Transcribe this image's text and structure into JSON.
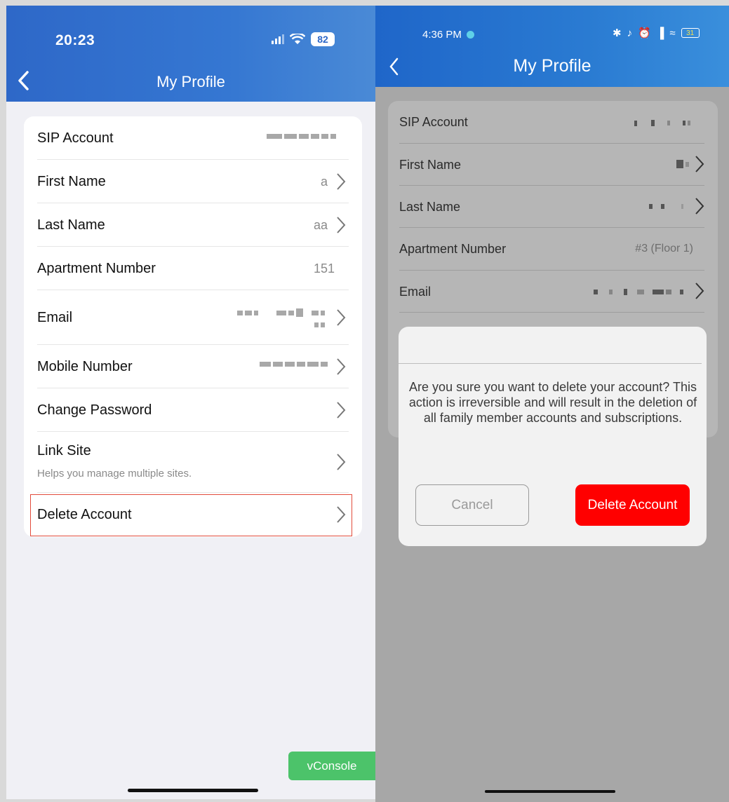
{
  "left": {
    "status": {
      "time": "20:23",
      "battery": "82"
    },
    "header": {
      "title": "My Profile"
    },
    "rows": [
      {
        "label": "SIP Account"
      },
      {
        "label": "First Name",
        "value": "a"
      },
      {
        "label": "Last Name",
        "value": "aa"
      },
      {
        "label": "Apartment Number",
        "value": "151"
      },
      {
        "label": "Email"
      },
      {
        "label": "Mobile Number"
      },
      {
        "label": "Change Password"
      },
      {
        "label": "Link Site",
        "sub": "Helps you manage multiple sites."
      },
      {
        "label": "Delete Account"
      }
    ],
    "vconsole": "vConsole",
    "highlight_color": "#e24b3b"
  },
  "right": {
    "status": {
      "time": "4:36 PM",
      "battery": "31"
    },
    "header": {
      "title": "My Profile"
    },
    "rows": [
      {
        "label": "SIP Account"
      },
      {
        "label": "First Name"
      },
      {
        "label": "Last Name"
      },
      {
        "label": "Apartment Number",
        "value": "#3 (Floor 1)"
      },
      {
        "label": "Email"
      }
    ],
    "dialog": {
      "message": "Are you sure you want to delete your account? This action is irreversible and will result in the deletion of all family member accounts and subscriptions.",
      "cancel_label": "Cancel",
      "delete_label": "Delete Account",
      "delete_color": "#ff0000"
    }
  },
  "icons": [
    "back-chevron-icon",
    "chevron-right-icon",
    "signal-icon",
    "wifi-icon",
    "battery-icon",
    "bluetooth-icon",
    "alarm-icon"
  ]
}
